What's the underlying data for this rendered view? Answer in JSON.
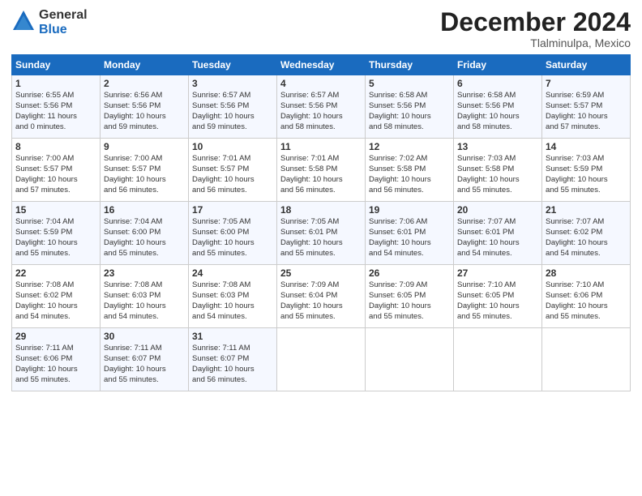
{
  "header": {
    "logo": {
      "line1": "General",
      "line2": "Blue"
    },
    "title": "December 2024",
    "location": "Tlalminulpa, Mexico"
  },
  "calendar": {
    "days_of_week": [
      "Sunday",
      "Monday",
      "Tuesday",
      "Wednesday",
      "Thursday",
      "Friday",
      "Saturday"
    ],
    "weeks": [
      [
        {
          "day": "",
          "info": ""
        },
        {
          "day": "2",
          "info": "Sunrise: 6:56 AM\nSunset: 5:56 PM\nDaylight: 10 hours\nand 59 minutes."
        },
        {
          "day": "3",
          "info": "Sunrise: 6:57 AM\nSunset: 5:56 PM\nDaylight: 10 hours\nand 59 minutes."
        },
        {
          "day": "4",
          "info": "Sunrise: 6:57 AM\nSunset: 5:56 PM\nDaylight: 10 hours\nand 58 minutes."
        },
        {
          "day": "5",
          "info": "Sunrise: 6:58 AM\nSunset: 5:56 PM\nDaylight: 10 hours\nand 58 minutes."
        },
        {
          "day": "6",
          "info": "Sunrise: 6:58 AM\nSunset: 5:56 PM\nDaylight: 10 hours\nand 58 minutes."
        },
        {
          "day": "7",
          "info": "Sunrise: 6:59 AM\nSunset: 5:57 PM\nDaylight: 10 hours\nand 57 minutes."
        }
      ],
      [
        {
          "day": "1",
          "info": "Sunrise: 6:55 AM\nSunset: 5:56 PM\nDaylight: 11 hours\nand 0 minutes."
        },
        {
          "day": "",
          "info": ""
        },
        {
          "day": "",
          "info": ""
        },
        {
          "day": "",
          "info": ""
        },
        {
          "day": "",
          "info": ""
        },
        {
          "day": "",
          "info": ""
        },
        {
          "day": "",
          "info": ""
        }
      ],
      [
        {
          "day": "8",
          "info": "Sunrise: 7:00 AM\nSunset: 5:57 PM\nDaylight: 10 hours\nand 57 minutes."
        },
        {
          "day": "9",
          "info": "Sunrise: 7:00 AM\nSunset: 5:57 PM\nDaylight: 10 hours\nand 56 minutes."
        },
        {
          "day": "10",
          "info": "Sunrise: 7:01 AM\nSunset: 5:57 PM\nDaylight: 10 hours\nand 56 minutes."
        },
        {
          "day": "11",
          "info": "Sunrise: 7:01 AM\nSunset: 5:58 PM\nDaylight: 10 hours\nand 56 minutes."
        },
        {
          "day": "12",
          "info": "Sunrise: 7:02 AM\nSunset: 5:58 PM\nDaylight: 10 hours\nand 56 minutes."
        },
        {
          "day": "13",
          "info": "Sunrise: 7:03 AM\nSunset: 5:58 PM\nDaylight: 10 hours\nand 55 minutes."
        },
        {
          "day": "14",
          "info": "Sunrise: 7:03 AM\nSunset: 5:59 PM\nDaylight: 10 hours\nand 55 minutes."
        }
      ],
      [
        {
          "day": "15",
          "info": "Sunrise: 7:04 AM\nSunset: 5:59 PM\nDaylight: 10 hours\nand 55 minutes."
        },
        {
          "day": "16",
          "info": "Sunrise: 7:04 AM\nSunset: 6:00 PM\nDaylight: 10 hours\nand 55 minutes."
        },
        {
          "day": "17",
          "info": "Sunrise: 7:05 AM\nSunset: 6:00 PM\nDaylight: 10 hours\nand 55 minutes."
        },
        {
          "day": "18",
          "info": "Sunrise: 7:05 AM\nSunset: 6:01 PM\nDaylight: 10 hours\nand 55 minutes."
        },
        {
          "day": "19",
          "info": "Sunrise: 7:06 AM\nSunset: 6:01 PM\nDaylight: 10 hours\nand 54 minutes."
        },
        {
          "day": "20",
          "info": "Sunrise: 7:07 AM\nSunset: 6:01 PM\nDaylight: 10 hours\nand 54 minutes."
        },
        {
          "day": "21",
          "info": "Sunrise: 7:07 AM\nSunset: 6:02 PM\nDaylight: 10 hours\nand 54 minutes."
        }
      ],
      [
        {
          "day": "22",
          "info": "Sunrise: 7:08 AM\nSunset: 6:02 PM\nDaylight: 10 hours\nand 54 minutes."
        },
        {
          "day": "23",
          "info": "Sunrise: 7:08 AM\nSunset: 6:03 PM\nDaylight: 10 hours\nand 54 minutes."
        },
        {
          "day": "24",
          "info": "Sunrise: 7:08 AM\nSunset: 6:03 PM\nDaylight: 10 hours\nand 54 minutes."
        },
        {
          "day": "25",
          "info": "Sunrise: 7:09 AM\nSunset: 6:04 PM\nDaylight: 10 hours\nand 55 minutes."
        },
        {
          "day": "26",
          "info": "Sunrise: 7:09 AM\nSunset: 6:05 PM\nDaylight: 10 hours\nand 55 minutes."
        },
        {
          "day": "27",
          "info": "Sunrise: 7:10 AM\nSunset: 6:05 PM\nDaylight: 10 hours\nand 55 minutes."
        },
        {
          "day": "28",
          "info": "Sunrise: 7:10 AM\nSunset: 6:06 PM\nDaylight: 10 hours\nand 55 minutes."
        }
      ],
      [
        {
          "day": "29",
          "info": "Sunrise: 7:11 AM\nSunset: 6:06 PM\nDaylight: 10 hours\nand 55 minutes."
        },
        {
          "day": "30",
          "info": "Sunrise: 7:11 AM\nSunset: 6:07 PM\nDaylight: 10 hours\nand 55 minutes."
        },
        {
          "day": "31",
          "info": "Sunrise: 7:11 AM\nSunset: 6:07 PM\nDaylight: 10 hours\nand 56 minutes."
        },
        {
          "day": "",
          "info": ""
        },
        {
          "day": "",
          "info": ""
        },
        {
          "day": "",
          "info": ""
        },
        {
          "day": "",
          "info": ""
        }
      ]
    ]
  }
}
